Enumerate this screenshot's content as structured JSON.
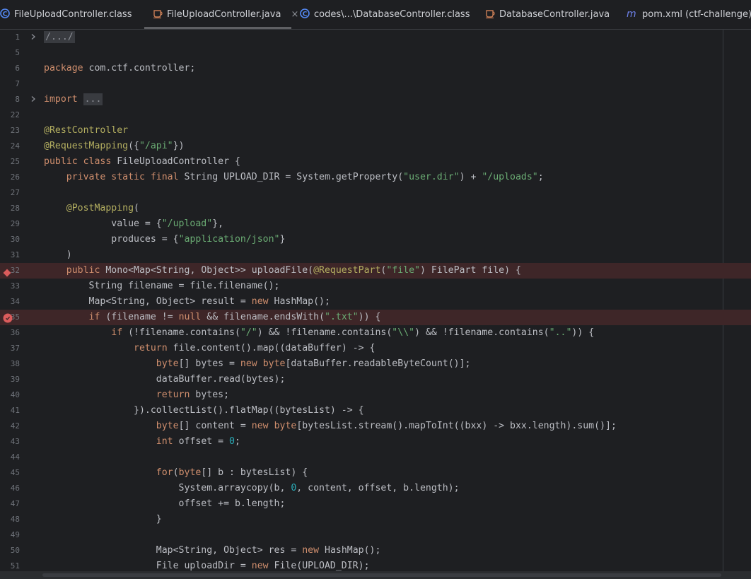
{
  "tabs": [
    {
      "label": "FileUploadController.class",
      "icon": "class-icon",
      "active": false,
      "closable": false
    },
    {
      "label": "FileUploadController.java",
      "icon": "java-file-icon",
      "active": true,
      "closable": true
    },
    {
      "label": "codes\\...\\DatabaseController.class",
      "icon": "class-icon",
      "active": false,
      "closable": false
    },
    {
      "label": "DatabaseController.java",
      "icon": "java-file-icon",
      "active": false,
      "closable": false
    },
    {
      "label": "pom.xml (ctf-challenge)",
      "icon": "maven-icon",
      "active": false,
      "closable": false
    }
  ],
  "close_glyph": "×",
  "colors": {
    "keyword": "#cf8e6d",
    "string": "#6aab73",
    "annotation": "#b3ae60",
    "number": "#2aacb8",
    "plain": "#bcbec4",
    "breakpoint_line": "#3e2628",
    "breakpoint": "#db5c5c"
  },
  "lines": [
    {
      "num": "1",
      "fold": true,
      "tokens": [
        [
          "fold",
          "/.../"
        ]
      ]
    },
    {
      "num": "5",
      "tokens": []
    },
    {
      "num": "6",
      "tokens": [
        [
          "kw",
          "package"
        ],
        [
          "pl",
          " com.ctf.controller;"
        ]
      ]
    },
    {
      "num": "7",
      "tokens": []
    },
    {
      "num": "8",
      "fold": true,
      "tokens": [
        [
          "kw",
          "import"
        ],
        [
          "pl",
          " "
        ],
        [
          "fold",
          "..."
        ]
      ]
    },
    {
      "num": "22",
      "tokens": []
    },
    {
      "num": "23",
      "tokens": [
        [
          "ann",
          "@RestController"
        ]
      ]
    },
    {
      "num": "24",
      "tokens": [
        [
          "ann",
          "@RequestMapping"
        ],
        [
          "pl",
          "({"
        ],
        [
          "str",
          "\"/api\""
        ],
        [
          "pl",
          "})"
        ]
      ]
    },
    {
      "num": "25",
      "tokens": [
        [
          "kw",
          "public class"
        ],
        [
          "pl",
          " FileUploadController {"
        ]
      ]
    },
    {
      "num": "26",
      "tokens": [
        [
          "pl",
          "    "
        ],
        [
          "kw",
          "private static final"
        ],
        [
          "pl",
          " String UPLOAD_DIR = System.getProperty("
        ],
        [
          "str",
          "\"user.dir\""
        ],
        [
          "pl",
          ") + "
        ],
        [
          "str",
          "\"/uploads\""
        ],
        [
          "pl",
          ";"
        ]
      ]
    },
    {
      "num": "27",
      "tokens": []
    },
    {
      "num": "28",
      "tokens": [
        [
          "pl",
          "    "
        ],
        [
          "ann",
          "@PostMapping"
        ],
        [
          "pl",
          "("
        ]
      ]
    },
    {
      "num": "29",
      "tokens": [
        [
          "pl",
          "            value = {"
        ],
        [
          "str",
          "\"/upload\""
        ],
        [
          "pl",
          "},"
        ]
      ]
    },
    {
      "num": "30",
      "tokens": [
        [
          "pl",
          "            produces = {"
        ],
        [
          "str",
          "\"application/json\""
        ],
        [
          "pl",
          "}"
        ]
      ]
    },
    {
      "num": "31",
      "tokens": [
        [
          "pl",
          "    )"
        ]
      ]
    },
    {
      "num": "32",
      "bp": "diamond",
      "tokens": [
        [
          "pl",
          "    "
        ],
        [
          "kw",
          "public"
        ],
        [
          "pl",
          " Mono<Map<String, Object>> uploadFile("
        ],
        [
          "ann",
          "@RequestPart"
        ],
        [
          "pl",
          "("
        ],
        [
          "str",
          "\"file\""
        ],
        [
          "pl",
          ") FilePart file) {"
        ]
      ]
    },
    {
      "num": "33",
      "tokens": [
        [
          "pl",
          "        String filename = file.filename();"
        ]
      ]
    },
    {
      "num": "34",
      "tokens": [
        [
          "pl",
          "        Map<String, Object> result = "
        ],
        [
          "kw",
          "new"
        ],
        [
          "pl",
          " HashMap();"
        ]
      ]
    },
    {
      "num": "35",
      "bp": "circle",
      "tokens": [
        [
          "pl",
          "        "
        ],
        [
          "kw",
          "if"
        ],
        [
          "pl",
          " (filename != "
        ],
        [
          "kw",
          "null"
        ],
        [
          "pl",
          " && filename.endsWith("
        ],
        [
          "str",
          "\".txt\""
        ],
        [
          "pl",
          ")) {"
        ]
      ]
    },
    {
      "num": "36",
      "tokens": [
        [
          "pl",
          "            "
        ],
        [
          "kw",
          "if"
        ],
        [
          "pl",
          " (!filename.contains("
        ],
        [
          "str",
          "\"/\""
        ],
        [
          "pl",
          ") && !filename.contains("
        ],
        [
          "str",
          "\"\\\\\""
        ],
        [
          "pl",
          ") && !filename.contains("
        ],
        [
          "str",
          "\"..\""
        ],
        [
          "pl",
          ")) {"
        ]
      ]
    },
    {
      "num": "37",
      "tokens": [
        [
          "pl",
          "                "
        ],
        [
          "kw",
          "return"
        ],
        [
          "pl",
          " file.content().map((dataBuffer) -> {"
        ]
      ]
    },
    {
      "num": "38",
      "tokens": [
        [
          "pl",
          "                    "
        ],
        [
          "kw",
          "byte"
        ],
        [
          "pl",
          "[] bytes = "
        ],
        [
          "kw",
          "new"
        ],
        [
          "pl",
          " "
        ],
        [
          "kw",
          "byte"
        ],
        [
          "pl",
          "[dataBuffer.readableByteCount()];"
        ]
      ]
    },
    {
      "num": "39",
      "tokens": [
        [
          "pl",
          "                    dataBuffer.read(bytes);"
        ]
      ]
    },
    {
      "num": "40",
      "tokens": [
        [
          "pl",
          "                    "
        ],
        [
          "kw",
          "return"
        ],
        [
          "pl",
          " bytes;"
        ]
      ]
    },
    {
      "num": "41",
      "tokens": [
        [
          "pl",
          "                }).collectList().flatMap((bytesList) -> {"
        ]
      ]
    },
    {
      "num": "42",
      "tokens": [
        [
          "pl",
          "                    "
        ],
        [
          "kw",
          "byte"
        ],
        [
          "pl",
          "[] content = "
        ],
        [
          "kw",
          "new"
        ],
        [
          "pl",
          " "
        ],
        [
          "kw",
          "byte"
        ],
        [
          "pl",
          "[bytesList.stream().mapToInt((bxx) -> bxx.length).sum()];"
        ]
      ]
    },
    {
      "num": "43",
      "tokens": [
        [
          "pl",
          "                    "
        ],
        [
          "kw",
          "int"
        ],
        [
          "pl",
          " offset = "
        ],
        [
          "num",
          "0"
        ],
        [
          "pl",
          ";"
        ]
      ]
    },
    {
      "num": "44",
      "tokens": []
    },
    {
      "num": "45",
      "tokens": [
        [
          "pl",
          "                    "
        ],
        [
          "kw",
          "for"
        ],
        [
          "pl",
          "("
        ],
        [
          "kw",
          "byte"
        ],
        [
          "pl",
          "[] b : bytesList) {"
        ]
      ]
    },
    {
      "num": "46",
      "tokens": [
        [
          "pl",
          "                        System.arraycopy(b, "
        ],
        [
          "num",
          "0"
        ],
        [
          "pl",
          ", content, offset, b.length);"
        ]
      ]
    },
    {
      "num": "47",
      "tokens": [
        [
          "pl",
          "                        offset += b.length;"
        ]
      ]
    },
    {
      "num": "48",
      "tokens": [
        [
          "pl",
          "                    }"
        ]
      ]
    },
    {
      "num": "49",
      "tokens": []
    },
    {
      "num": "50",
      "tokens": [
        [
          "pl",
          "                    Map<String, Object> res = "
        ],
        [
          "kw",
          "new"
        ],
        [
          "pl",
          " HashMap();"
        ]
      ]
    },
    {
      "num": "51",
      "tokens": [
        [
          "pl",
          "                    File uploadDir = "
        ],
        [
          "kw",
          "new"
        ],
        [
          "pl",
          " File(UPLOAD_DIR);"
        ]
      ]
    }
  ]
}
